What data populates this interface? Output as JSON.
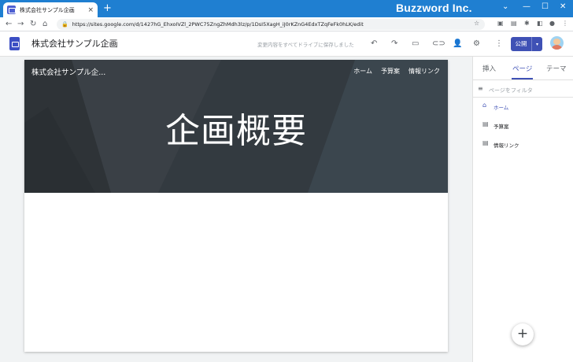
{
  "browser": {
    "tab_title": "株式会社サンプル企画",
    "tab_close": "×",
    "new_tab": "+",
    "brand": "Buzzword Inc.",
    "url": "https://sites.google.com/d/1427hG_EhxoIVZl_2PWC75ZngZhMdh3lz/p/1DsI5XagH_iJ0rKZnG4EdxTZqFeFk0hLK/edit",
    "nav": {
      "back": "←",
      "forward": "→",
      "reload": "↻",
      "home": "⌂"
    },
    "win": {
      "chevron": "⌄",
      "min": "—",
      "max": "☐",
      "close": "✕"
    }
  },
  "sites_toolbar": {
    "doc_title": "株式会社サンプル企画",
    "save_status": "変更内容をすべてドライブに保存しました",
    "publish_label": "公開",
    "publish_dropdown": "▾"
  },
  "site": {
    "site_name": "株式会社サンプル企...",
    "nav_items": [
      "ホーム",
      "予算案",
      "情報リンク"
    ],
    "hero_title": "企画概要"
  },
  "panel": {
    "tabs": [
      "挿入",
      "ページ",
      "テーマ"
    ],
    "active_tab": "ページ",
    "filter_placeholder": "ページをフィルタ",
    "pages": [
      {
        "label": "ホーム",
        "icon": "home-icon",
        "active": true
      },
      {
        "label": "予算案",
        "icon": "page-icon",
        "active": false
      },
      {
        "label": "情報リンク",
        "icon": "page-icon",
        "active": false
      }
    ],
    "fab_label": "+"
  },
  "colors": {
    "accent": "#3f51b5",
    "tabstrip": "#1f7fd1",
    "header_band": "#353b40"
  }
}
